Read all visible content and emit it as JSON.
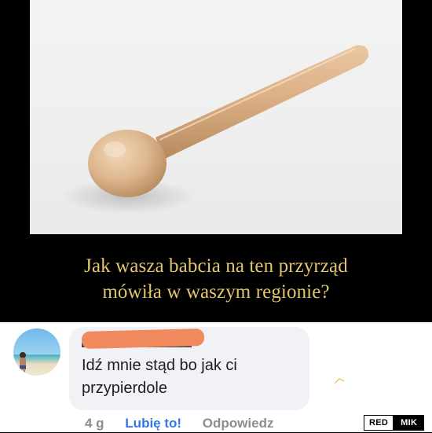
{
  "meme": {
    "photo_subject": "wooden-spoon-icon",
    "caption_line1": "Jak wasza babcia na ten przyrząd",
    "caption_line2": "mówiła w waszym regionie?"
  },
  "comment": {
    "text": "Idź mnie stąd bo jak ci\nprzypierdole",
    "time": "4 g",
    "like": "Lubię to!",
    "reply": "Odpowiedz"
  },
  "watermark": {
    "left": "RED",
    "right": "MIK"
  },
  "colors": {
    "caption": "#e3c56b",
    "bubble": "#f0f2f5",
    "like": "#3578e5",
    "redaction": "#f08a5e"
  }
}
